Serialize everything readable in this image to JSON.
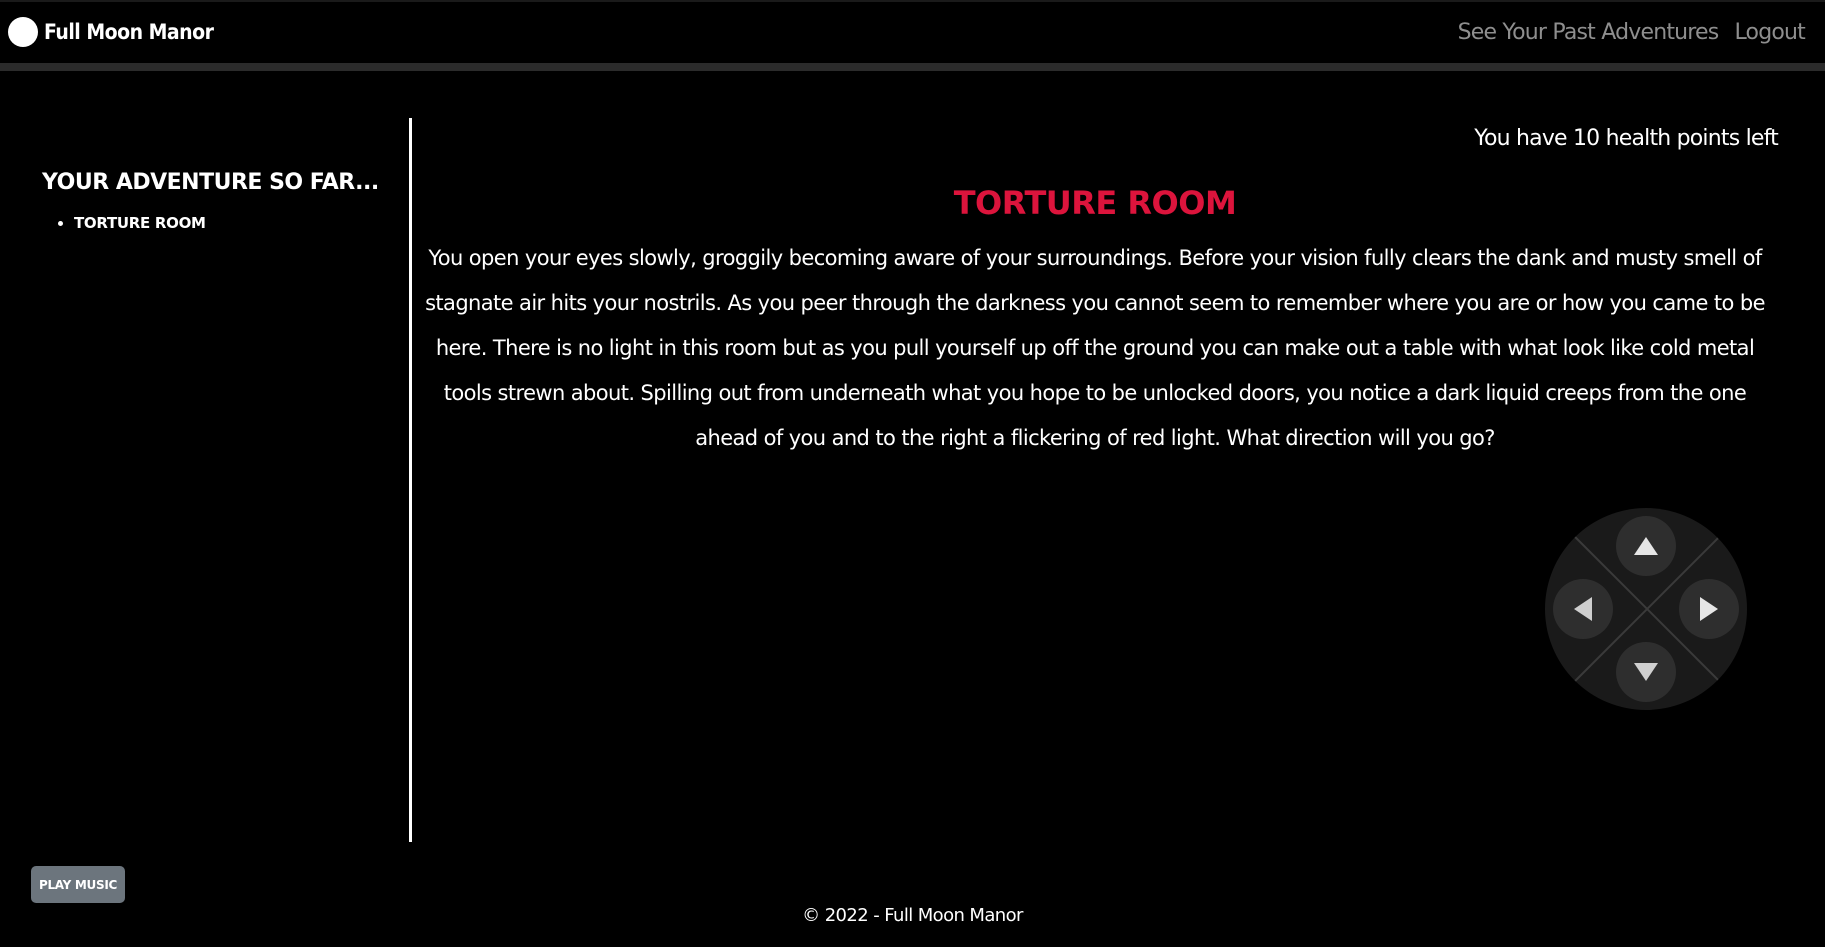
{
  "nav": {
    "brand": "Full Moon Manor",
    "links": [
      "See Your Past Adventures",
      "Logout"
    ]
  },
  "sidebar": {
    "title": "Your Adventure So Far...",
    "history": [
      "Torture Room"
    ]
  },
  "main": {
    "health": "You have 10 health points left",
    "room_title": "Torture Room",
    "room_description": "You open your eyes slowly, groggily becoming aware of your surroundings. Before your vision fully clears the dank and musty smell of stagnate air hits your nostrils. As you peer through the darkness you cannot seem to remember where you are or how you came to be here. There is no light in this room but as you pull yourself up off the ground you can make out a table with what look like cold metal tools strewn about. Spilling out from underneath what you hope to be unlocked doors, you notice a dark liquid creeps from the one ahead of you and to the right a flickering of red light. What direction will you go?"
  },
  "controls": {
    "up_icon": "arrow-up-icon",
    "down_icon": "arrow-down-icon",
    "left_icon": "arrow-left-icon",
    "right_icon": "arrow-right-icon"
  },
  "music_button": "Play Music",
  "footer": "© 2022 - Full Moon Manor",
  "colors": {
    "background": "#000000",
    "room_title": "#dc143c",
    "nav_link": "#8e8e8e",
    "music_button": "#6c757d"
  }
}
